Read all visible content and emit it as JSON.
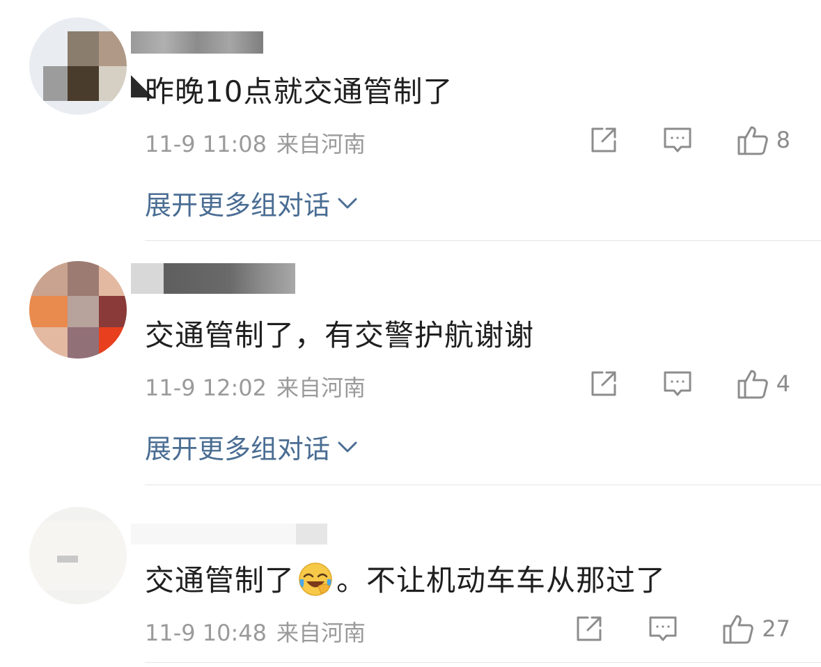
{
  "comments": [
    {
      "text": "昨晚10点就交通管制了",
      "date": "11-9 11:08",
      "location": "来自河南",
      "likes": "8",
      "expand_label": "展开更多组对话"
    },
    {
      "text": "交通管制了，有交警护航谢谢",
      "date": "11-9 12:02",
      "location": "来自河南",
      "likes": "4",
      "expand_label": "展开更多组对话"
    },
    {
      "text_before": "交通管制了",
      "emoji": "laughing-crying-emoji",
      "text_after": "。不让机动车车从那过了",
      "date": "11-9 10:48",
      "location": "来自河南",
      "likes": "27"
    }
  ],
  "icons": {
    "share": "share-icon",
    "comment": "comment-icon",
    "like": "like-icon",
    "expand": "chevron-down-icon"
  },
  "colors": {
    "link": "#4a6d93",
    "meta": "#9a9a9a",
    "text": "#1f1f1f"
  }
}
